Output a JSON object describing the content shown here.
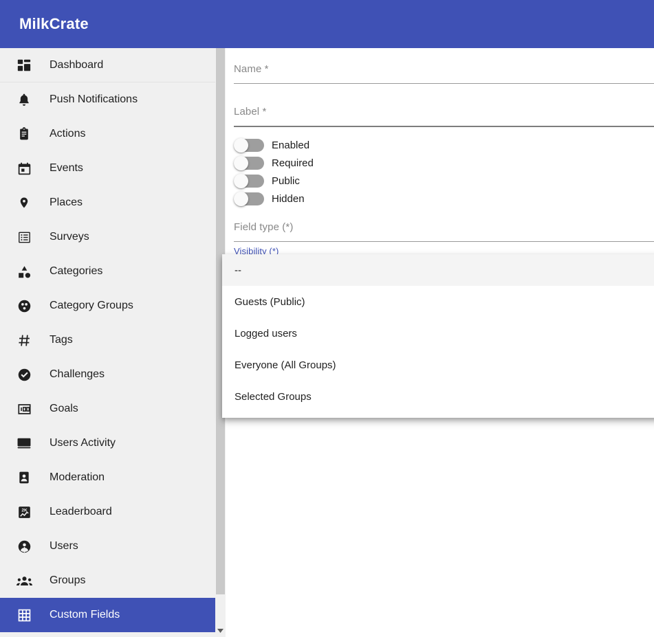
{
  "app": {
    "title": "MilkCrate",
    "brand_color": "#3f51b5"
  },
  "sidebar": {
    "items": [
      {
        "label": "Dashboard",
        "icon": "dashboard-icon",
        "active": false
      },
      {
        "label": "Push Notifications",
        "icon": "bell-icon",
        "active": false
      },
      {
        "label": "Actions",
        "icon": "clipboard-icon",
        "active": false
      },
      {
        "label": "Events",
        "icon": "calendar-icon",
        "active": false
      },
      {
        "label": "Places",
        "icon": "map-pin-icon",
        "active": false
      },
      {
        "label": "Surveys",
        "icon": "list-box-icon",
        "active": false
      },
      {
        "label": "Categories",
        "icon": "shapes-icon",
        "active": false
      },
      {
        "label": "Category Groups",
        "icon": "circle-dots-icon",
        "active": false
      },
      {
        "label": "Tags",
        "icon": "hash-icon",
        "active": false
      },
      {
        "label": "Challenges",
        "icon": "check-circle-icon",
        "active": false
      },
      {
        "label": "Goals",
        "icon": "counter-100-icon",
        "active": false
      },
      {
        "label": "Users Activity",
        "icon": "card-icon",
        "active": false
      },
      {
        "label": "Moderation",
        "icon": "badge-person-icon",
        "active": false
      },
      {
        "label": "Leaderboard",
        "icon": "leaderboard-2k-icon",
        "active": false
      },
      {
        "label": "Users",
        "icon": "user-circle-icon",
        "active": false
      },
      {
        "label": "Groups",
        "icon": "people-group-icon",
        "active": false
      },
      {
        "label": "Custom Fields",
        "icon": "grid-table-icon",
        "active": true
      }
    ]
  },
  "scrollbar": {
    "down_arrow_icon": "chevron-down-icon"
  },
  "form": {
    "name_field": {
      "label": "Name *",
      "value": "",
      "placeholder": "Name *"
    },
    "label_field": {
      "label": "Label *",
      "value": "",
      "placeholder": "Label *"
    },
    "toggles": [
      {
        "label": "Enabled",
        "on": false
      },
      {
        "label": "Required",
        "on": false
      },
      {
        "label": "Public",
        "on": false
      },
      {
        "label": "Hidden",
        "on": false
      }
    ],
    "field_type": {
      "label": "Field type (*)",
      "value": ""
    },
    "visibility": {
      "label": "Visibility (*)",
      "value": ""
    }
  },
  "dropdown": {
    "open": true,
    "options": [
      {
        "label": "--",
        "highlighted": true
      },
      {
        "label": "Guests (Public)",
        "highlighted": false
      },
      {
        "label": "Logged users",
        "highlighted": false
      },
      {
        "label": "Everyone (All Groups)",
        "highlighted": false
      },
      {
        "label": "Selected Groups",
        "highlighted": false
      }
    ]
  }
}
